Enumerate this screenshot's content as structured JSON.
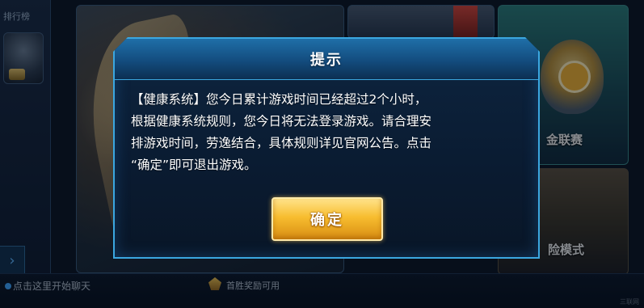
{
  "background": {
    "rank_label": "排行榜",
    "right_title_top": "金联赛",
    "right_title_bottom": "险模式",
    "chat_hint": "点击这里开始聊天",
    "reward_text": "首胜奖励可用",
    "watermark": "三联网"
  },
  "dialog": {
    "title": "提示",
    "message_lines": [
      "【健康系统】您今日累计游戏时间已经超过2个小时，",
      "根据健康系统规则，您今日将无法登录游戏。请合理安",
      "排游戏时间，劳逸结合，具体规则详见官网公告。点击",
      "“确定”即可退出游戏。"
    ],
    "confirm_label": "确定"
  },
  "colors": {
    "dialog_border": "#3ba7e0",
    "confirm_button": "#f7bd2f"
  }
}
